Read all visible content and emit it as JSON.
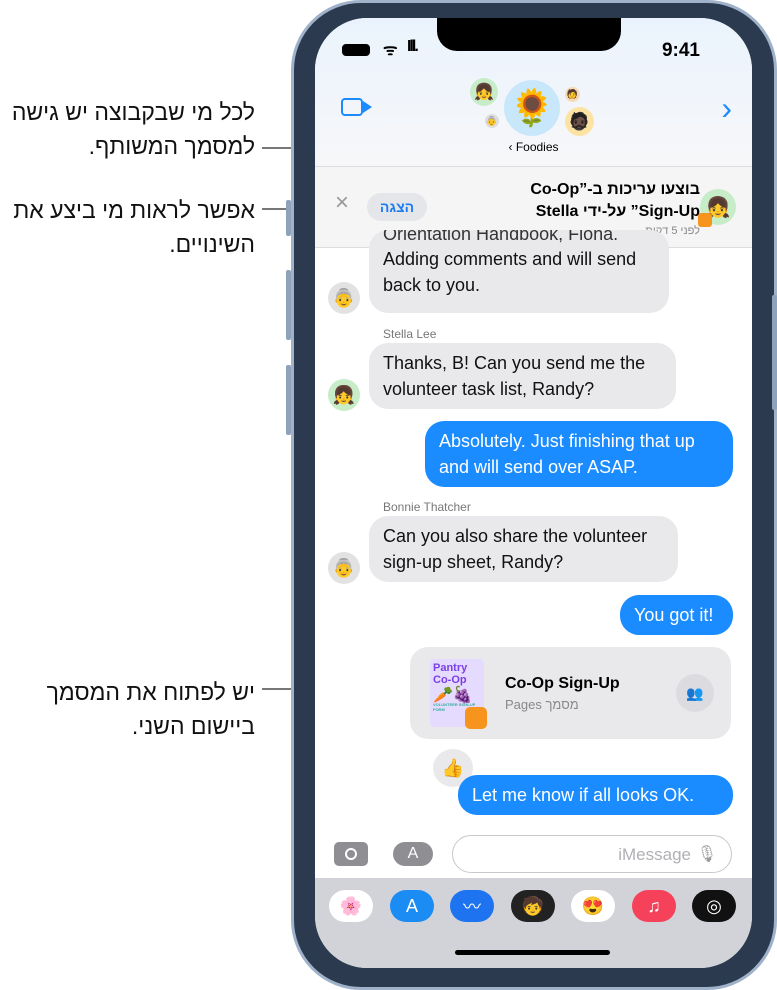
{
  "callouts": [
    {
      "text": "לכל מי שבקבוצה יש גישה למסמך המשותף."
    },
    {
      "text": "אפשר לראות מי ביצע את השינויים."
    },
    {
      "text": "יש לפתוח את המסמך ביישום השני."
    }
  ],
  "status_bar": {
    "time": "9:41"
  },
  "header": {
    "group_name": "Foodies",
    "back_chevron": "‹",
    "video_icon": "video-camera-icon",
    "details_icon": "chevron-right-icon"
  },
  "banner": {
    "title_line1": "בוצעו עריכות ב-”Co-Op",
    "title_line2": "Sign-Up” על-ידי Stella",
    "time": "לפני 5 דקות",
    "show_label": "הצגה",
    "close": "×"
  },
  "messages": [
    {
      "text_clipped": "Orientation Handbook, Fiona.",
      "text": "Adding comments and will send back to you."
    },
    {
      "sender": "Stella Lee",
      "text": "Thanks, B! Can you send me the volunteer task list, Randy?"
    },
    {
      "text": "Absolutely. Just finishing that up and will send over ASAP."
    },
    {
      "sender": "Bonnie Thatcher",
      "text": "Can you also share the volunteer sign-up sheet, Randy?"
    },
    {
      "text": "You got it!"
    },
    {
      "text": "Let me know if all looks OK."
    }
  ],
  "document": {
    "title": "Co-Op Sign-Up",
    "subtitle": "מסמך Pages",
    "thumb_title": "Pantry Co-Op",
    "thumb_footer": "VOLUNTEER SIGN-UP FORM"
  },
  "input": {
    "placeholder": "iMessage"
  },
  "colors": {
    "accent": "#1a8cff",
    "incoming": "#e9e9eb",
    "drawer": "#d1d3d9"
  },
  "app_drawer": [
    "photos",
    "app-store",
    "audio-message",
    "memoji",
    "memoji-stickers",
    "music",
    "activity"
  ]
}
